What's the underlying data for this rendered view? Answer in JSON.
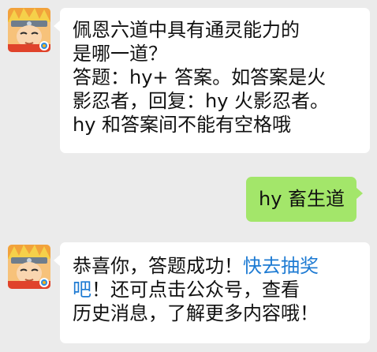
{
  "colors": {
    "background": "#ebebeb",
    "incoming_bubble": "#ffffff",
    "outgoing_bubble": "#a3e66a",
    "link": "#1e7bd3"
  },
  "messages": [
    {
      "sender": "official-account",
      "avatar": "naruto-avatar",
      "lines": [
        "佩恩六道中具有通灵能力的",
        "是哪一道？",
        "答题：hy+ 答案。如答案是火",
        "影忍者，回复：hy 火影忍者。",
        "hy 和答案间不能有空格哦"
      ]
    },
    {
      "sender": "user",
      "text": "hy 畜生道"
    },
    {
      "sender": "official-account",
      "avatar": "naruto-avatar",
      "line1_text": "恭喜你，答题成功！",
      "line1_link": "快去抽奖",
      "line2_link": "吧",
      "line2_text": "！还可点击公众号，查看",
      "line3": "历史消息，了解更多内容哦！"
    }
  ]
}
